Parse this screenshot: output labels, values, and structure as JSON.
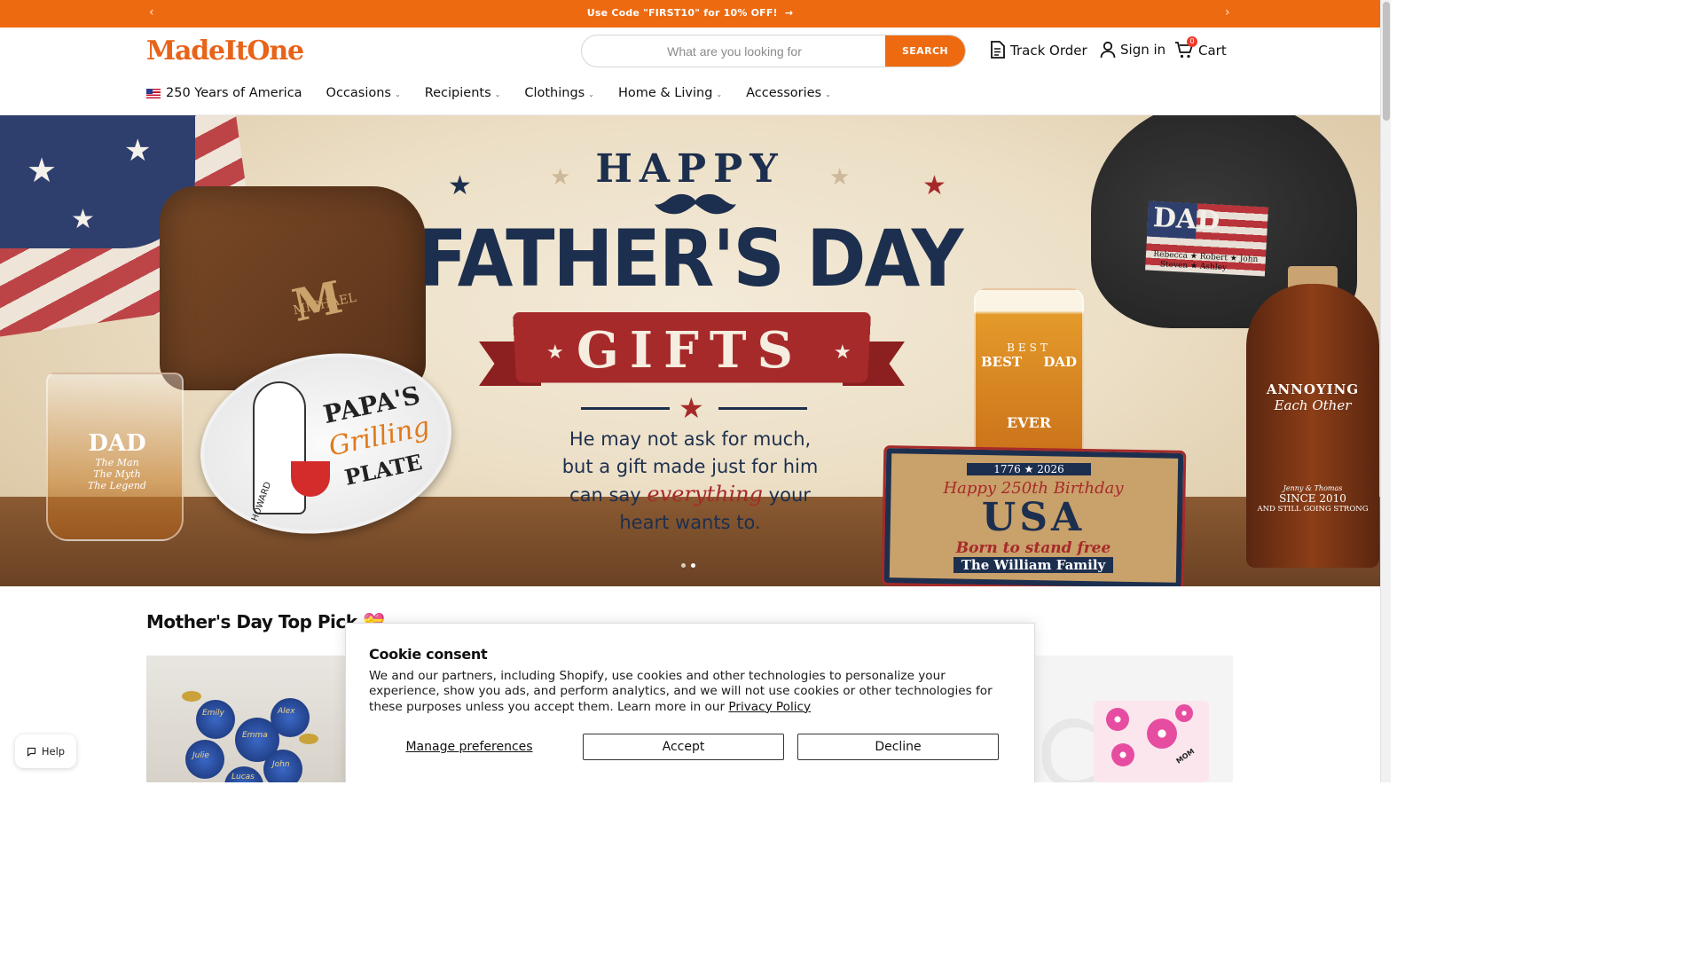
{
  "announcement": {
    "message": "Use Code \"FIRST10\" for 10% OFF!",
    "arrow": "→",
    "prev": "‹",
    "next": "›"
  },
  "header": {
    "logo": "MadeItOne",
    "search_placeholder": "What are you looking for",
    "search_button": "SEARCH",
    "track_order": "Track Order",
    "sign_in": "Sign in",
    "cart": "Cart",
    "cart_count": "0"
  },
  "nav": {
    "items": [
      {
        "label": "250 Years of America",
        "icon": "us-flag-icon",
        "has_dropdown": false
      },
      {
        "label": "Occasions",
        "has_dropdown": true
      },
      {
        "label": "Recipients",
        "has_dropdown": true
      },
      {
        "label": "Clothings",
        "has_dropdown": true
      },
      {
        "label": "Home & Living",
        "has_dropdown": true
      },
      {
        "label": "Accessories",
        "has_dropdown": true
      }
    ],
    "chevron": "⌄"
  },
  "hero": {
    "happy": "HAPPY",
    "fathers_day": "FATHER'S DAY",
    "gifts": "GIFTS",
    "tagline_1": "He may not ask for much,",
    "tagline_2a": "but a gift made just for him",
    "tagline_3a": "can say ",
    "tagline_3em": "everything",
    "tagline_3b": " your",
    "tagline_4": "heart wants to.",
    "bag_name": "MICHAEL",
    "bag_monogram": "M",
    "glass_title": "DAD",
    "glass_sub1": "The Man",
    "glass_sub2": "The Myth",
    "glass_sub3": "The Legend",
    "plate_line1": "PAPA'S",
    "plate_line2": "Grilling",
    "plate_line3": "PLATE",
    "plate_name": "HOWARD",
    "beer_best": "BEST",
    "beer_left": "BEST",
    "beer_right": "DAD",
    "beer_ever": "EVER",
    "cap_title": "DAD",
    "cap_names1": "Rebecca ★ Robert ★ John",
    "cap_names2": "Steven ★ Ashley",
    "bottle_line1": "ANNOYING",
    "bottle_line2": "Each Other",
    "bottle_names": "Jenny & Thomas",
    "bottle_since": "SINCE 2010",
    "bottle_strong": "AND STILL GOING STRONG",
    "mat_years": "1776 ★ 2026",
    "mat_bday": "Happy 250th Birthday",
    "mat_usa": "USA",
    "mat_born": "Born to stand free",
    "mat_family": "The William Family",
    "slide_count": 2,
    "active_slide": 2
  },
  "section": {
    "title": "Mother's Day Top Pick",
    "emoji": "💝"
  },
  "products": {
    "card1": {
      "names": [
        "Emily",
        "Alex",
        "Emma",
        "Julie",
        "John",
        "Lucas"
      ]
    },
    "card2": {
      "mug_text": "MOM"
    }
  },
  "help": {
    "label": "Help"
  },
  "cookie": {
    "title": "Cookie consent",
    "body": "We and our partners, including Shopify, use cookies and other technologies to personalize your experience, show you ads, and perform analytics, and we will not use cookies or other technologies for these purposes unless you accept them. Learn more in our ",
    "privacy_link": "Privacy Policy",
    "manage": "Manage preferences",
    "accept": "Accept",
    "decline": "Decline"
  },
  "colors": {
    "brand": "#ee6a10",
    "navy": "#1d2f4e",
    "red": "#a62a2a"
  }
}
